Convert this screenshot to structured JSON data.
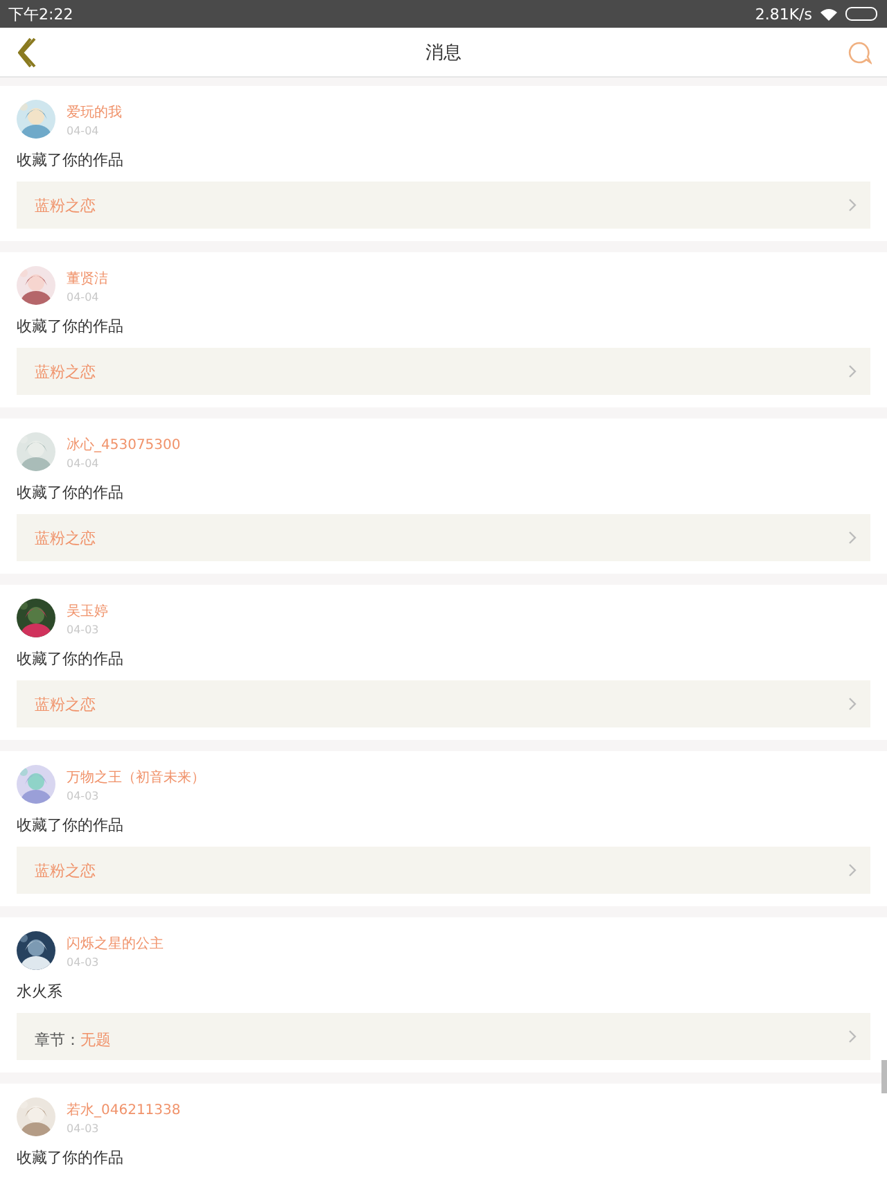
{
  "status_bar": {
    "time": "下午2:22",
    "speed": "2.81K/s"
  },
  "header": {
    "title": "消息"
  },
  "messages": [
    {
      "user": "爱玩的我",
      "date": "04-04",
      "action": "收藏了你的作品",
      "link": {
        "kind": "work",
        "title": "蓝粉之恋"
      }
    },
    {
      "user": "董贤洁",
      "date": "04-04",
      "action": "收藏了你的作品",
      "link": {
        "kind": "work",
        "title": "蓝粉之恋"
      }
    },
    {
      "user": "冰心_453075300",
      "date": "04-04",
      "action": "收藏了你的作品",
      "link": {
        "kind": "work",
        "title": "蓝粉之恋"
      }
    },
    {
      "user": "吴玉婷",
      "date": "04-03",
      "action": "收藏了你的作品",
      "link": {
        "kind": "work",
        "title": "蓝粉之恋"
      }
    },
    {
      "user": "万物之王（初音未来）",
      "date": "04-03",
      "action": "收藏了你的作品",
      "link": {
        "kind": "work",
        "title": "蓝粉之恋"
      }
    },
    {
      "user": "闪烁之星的公主",
      "date": "04-03",
      "action": "水火系",
      "link": {
        "kind": "chapter",
        "label": "章节：",
        "title": "无题"
      }
    },
    {
      "user": "若水_046211338",
      "date": "04-03",
      "action": "收藏了你的作品"
    }
  ]
}
